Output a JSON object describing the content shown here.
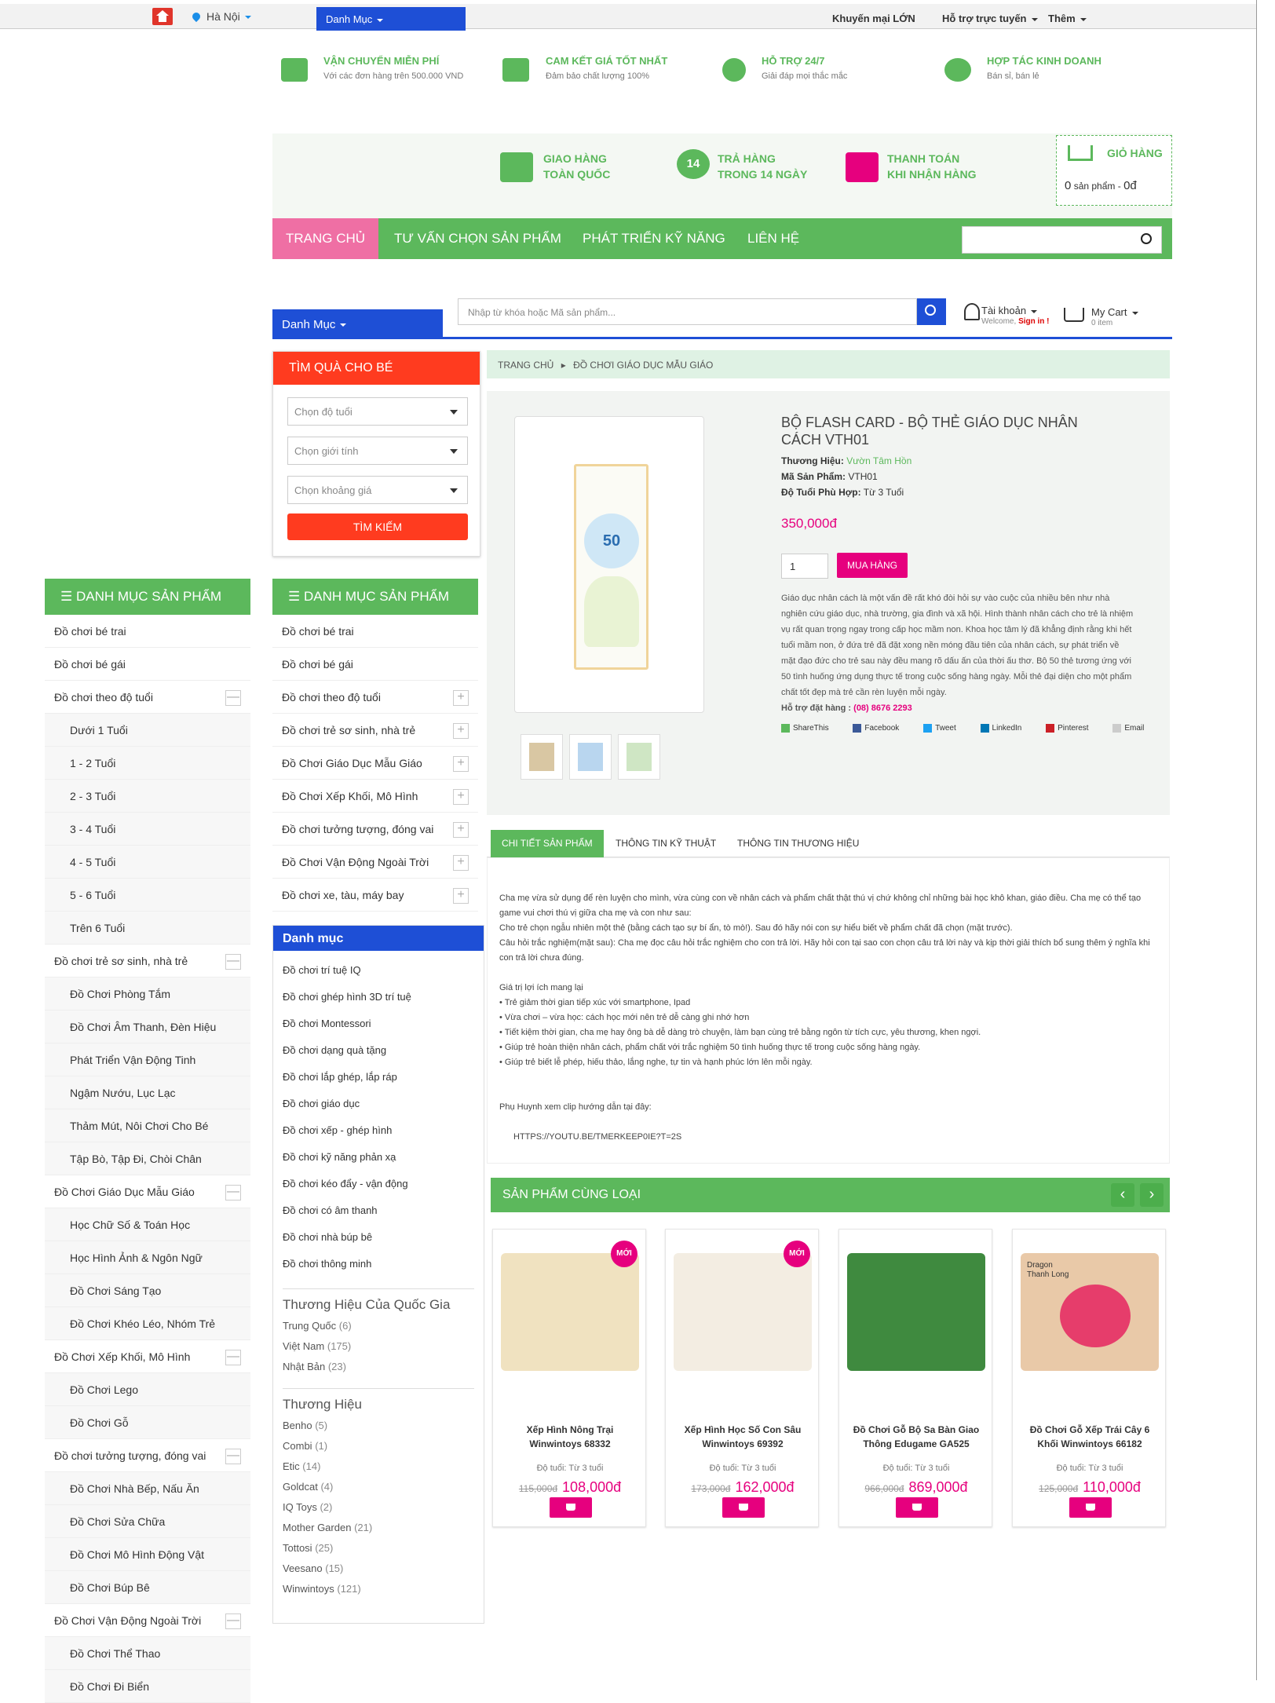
{
  "topbar": {
    "location": "Hà Nội",
    "category": "Danh Mục",
    "links": [
      "Khuyến mại LỚN",
      "Hỗ trợ trực tuyến",
      "Thêm"
    ]
  },
  "services": [
    {
      "title": "VẬN CHUYỂN MIỄN PHÍ",
      "sub": "Với các đơn hàng trên 500.000 VND"
    },
    {
      "title": "CAM KẾT GIÁ TỐT NHẤT",
      "sub": "Đảm bảo chất lượng 100%"
    },
    {
      "title": "HỖ TRỢ 24/7",
      "sub": "Giải đáp mọi thắc mắc"
    },
    {
      "title": "HỢP TÁC KINH DOANH",
      "sub": "Bán sỉ, bán lẻ"
    }
  ],
  "promo": [
    {
      "l1": "GIAO HÀNG",
      "l2": "TOÀN QUỐC"
    },
    {
      "l1": "TRẢ HÀNG",
      "l2": "TRONG 14 NGÀY"
    },
    {
      "l1": "THANH TOÁN",
      "l2": "KHI NHẬN HÀNG"
    }
  ],
  "promo_badge": "14",
  "cart": {
    "title": "GIỎ HÀNG",
    "count": "0",
    "count_label": "sản phẩm",
    "total": "0đ"
  },
  "nav": [
    "TRANG CHỦ",
    "TƯ VẤN CHỌN SẢN PHẨM",
    "PHÁT TRIỂN KỸ NĂNG",
    "LIÊN HỆ"
  ],
  "search": {
    "category": "Danh Mục",
    "placeholder": "Nhập từ khóa hoặc Mã sản phẩm..."
  },
  "account": {
    "title": "Tài khoản",
    "welcome": "Welcome,",
    "signin": "Sign in !",
    "cart_title": "My Cart",
    "cart_items": "0 item"
  },
  "gift": {
    "title": "TÌM QUÀ CHO BÉ",
    "selects": [
      "Chọn độ tuổi",
      "Chọn giới tính",
      "Chọn khoảng giá"
    ],
    "button": "TÌM KIẾM"
  },
  "cat_left": {
    "title": "DANH MỤC SẢN PHẨM",
    "items": [
      {
        "label": "Đồ chơi bé trai",
        "sub": false,
        "pm": ""
      },
      {
        "label": "Đồ chơi bé gái",
        "sub": false,
        "pm": ""
      },
      {
        "label": "Đồ chơi theo độ tuổi",
        "sub": false,
        "pm": "—"
      },
      {
        "label": "Dưới 1 Tuổi",
        "sub": true,
        "pm": ""
      },
      {
        "label": "1 - 2 Tuổi",
        "sub": true,
        "pm": ""
      },
      {
        "label": "2 - 3 Tuổi",
        "sub": true,
        "pm": ""
      },
      {
        "label": "3 - 4 Tuổi",
        "sub": true,
        "pm": ""
      },
      {
        "label": "4 - 5 Tuổi",
        "sub": true,
        "pm": ""
      },
      {
        "label": "5 - 6 Tuổi",
        "sub": true,
        "pm": ""
      },
      {
        "label": "Trên 6 Tuổi",
        "sub": true,
        "pm": ""
      },
      {
        "label": "Đồ chơi trẻ sơ sinh, nhà trẻ",
        "sub": false,
        "pm": "—"
      },
      {
        "label": "Đồ Chơi Phòng Tắm",
        "sub": true,
        "pm": ""
      },
      {
        "label": "Đồ Chơi Âm Thanh, Đèn Hiệu",
        "sub": true,
        "pm": ""
      },
      {
        "label": "Phát Triển Vận Động Tinh",
        "sub": true,
        "pm": ""
      },
      {
        "label": "Ngậm Nướu, Lục Lạc",
        "sub": true,
        "pm": ""
      },
      {
        "label": "Thảm Mút, Nôi Chơi Cho Bé",
        "sub": true,
        "pm": ""
      },
      {
        "label": "Tập Bò, Tập Đi, Chòi Chân",
        "sub": true,
        "pm": ""
      },
      {
        "label": "Đồ Chơi Giáo Dục Mẫu Giáo",
        "sub": false,
        "pm": "—"
      },
      {
        "label": "Học Chữ Số & Toán Học",
        "sub": true,
        "pm": ""
      },
      {
        "label": "Học Hình Ảnh & Ngôn Ngữ",
        "sub": true,
        "pm": ""
      },
      {
        "label": "Đồ Chơi Sáng Tạo",
        "sub": true,
        "pm": ""
      },
      {
        "label": "Đồ Chơi Khéo Léo, Nhóm Trẻ",
        "sub": true,
        "pm": ""
      },
      {
        "label": "Đồ Chơi Xếp Khối, Mô Hình",
        "sub": false,
        "pm": "—"
      },
      {
        "label": "Đồ Chơi Lego",
        "sub": true,
        "pm": ""
      },
      {
        "label": "Đồ Chơi Gỗ",
        "sub": true,
        "pm": ""
      },
      {
        "label": "Đồ chơi tưởng tượng, đóng vai",
        "sub": false,
        "pm": "—"
      },
      {
        "label": "Đồ Chơi Nhà Bếp, Nấu Ăn",
        "sub": true,
        "pm": ""
      },
      {
        "label": "Đồ Chơi Sửa Chữa",
        "sub": true,
        "pm": ""
      },
      {
        "label": "Đồ Chơi Mô Hình Động Vật",
        "sub": true,
        "pm": ""
      },
      {
        "label": "Đồ Chơi Búp Bê",
        "sub": true,
        "pm": ""
      },
      {
        "label": "Đồ Chơi Vận Động Ngoài Trời",
        "sub": false,
        "pm": "—"
      },
      {
        "label": "Đồ Chơi Thể Thao",
        "sub": true,
        "pm": ""
      },
      {
        "label": "Đồ Chơi Đi Biển",
        "sub": true,
        "pm": ""
      }
    ]
  },
  "cat_mid": {
    "title": "DANH MỤC SẢN PHẨM",
    "items": [
      {
        "label": "Đồ chơi bé trai",
        "pm": ""
      },
      {
        "label": "Đồ chơi bé gái",
        "pm": ""
      },
      {
        "label": "Đồ chơi theo độ tuổi",
        "pm": "+"
      },
      {
        "label": "Đồ chơi trẻ sơ sinh, nhà trẻ",
        "pm": "+"
      },
      {
        "label": "Đồ Chơi Giáo Dục Mẫu Giáo",
        "pm": "+"
      },
      {
        "label": "Đồ Chơi Xếp Khối, Mô Hình",
        "pm": "+"
      },
      {
        "label": "Đồ chơi tưởng tượng, đóng vai",
        "pm": "+"
      },
      {
        "label": "Đồ Chơi Vận Động Ngoài Trời",
        "pm": "+"
      },
      {
        "label": "Đồ chơi xe, tàu, máy bay",
        "pm": "+"
      }
    ]
  },
  "danhmuc": {
    "title": "Danh mục",
    "items": [
      "Đồ chơi trí tuệ IQ",
      "Đồ chơi ghép hình 3D trí tuệ",
      "Đồ chơi Montessori",
      "Đồ chơi dạng quà tặng",
      "Đồ chơi lắp ghép, lắp ráp",
      "Đồ chơi giáo dục",
      "Đồ chơi xếp - ghép hình",
      "Đồ chơi kỹ năng phản xạ",
      "Đồ chơi kéo đẩy - vận động",
      "Đồ chơi có âm thanh",
      "Đồ chơi nhà búp bê",
      "Đồ chơi thông minh"
    ]
  },
  "brand_country": {
    "title": "Thương Hiệu Của Quốc Gia",
    "items": [
      {
        "n": "Trung Quốc",
        "c": "(6)"
      },
      {
        "n": "Việt Nam",
        "c": "(175)"
      },
      {
        "n": "Nhật Bản",
        "c": "(23)"
      }
    ]
  },
  "brands": {
    "title": "Thương Hiệu",
    "items": [
      {
        "n": "Benho",
        "c": "(5)"
      },
      {
        "n": "Combi",
        "c": "(1)"
      },
      {
        "n": "Etic",
        "c": "(14)"
      },
      {
        "n": "Goldcat",
        "c": "(4)"
      },
      {
        "n": "IQ Toys",
        "c": "(2)"
      },
      {
        "n": "Mother Garden",
        "c": "(21)"
      },
      {
        "n": "Tottosi",
        "c": "(25)"
      },
      {
        "n": "Veesano",
        "c": "(15)"
      },
      {
        "n": "Winwintoys",
        "c": "(121)"
      }
    ]
  },
  "breadcrumb": {
    "home": "TRANG CHỦ",
    "current": "ĐỒ CHƠI GIÁO DỤC MẪU GIÁO"
  },
  "product": {
    "title": "BỘ FLASH CARD - BỘ THẺ GIÁO DỤC NHÂN CÁCH VTH01",
    "brand_label": "Thương Hiệu:",
    "brand": "Vườn Tâm Hồn",
    "sku_label": "Mã Sản Phẩm:",
    "sku": "VTH01",
    "age_label": "Độ Tuổi Phù Hợp:",
    "age": "Từ 3 Tuổi",
    "price": "350,000đ",
    "qty": "1",
    "buy": "MUA HÀNG",
    "desc": "Giáo dục nhân cách là một vấn đề rất khó đòi hỏi sự vào cuộc của nhiều bên như nhà nghiên cứu giáo dục, nhà trường, gia đình và xã hội. Hình thành nhân cách cho trẻ là nhiệm vụ rất quan trọng ngay trong cấp học mầm non. Khoa học tâm lý đã khẳng định rằng khi hết tuổi mầm non, ở đứa trẻ đã đặt xong nền móng đầu tiên của nhân cách, sự phát triển về mặt đạo đức cho trẻ sau này đều mang rõ dấu ấn của thời ấu thơ. Bộ 50 thẻ tương ứng với 50 tình huống ứng dụng thực tế trong cuộc sống hàng ngày. Mỗi thẻ đại diện cho một phẩm chất tốt đẹp mà trẻ cần rèn luyện mỗi ngày.",
    "hotline_label": "Hỗ trợ đặt hàng :",
    "hotline": "(08) 8676 2293",
    "share": [
      "ShareThis",
      "Facebook",
      "Tweet",
      "LinkedIn",
      "Pinterest",
      "Email"
    ],
    "box_text": "50"
  },
  "tabs": [
    "CHI TIẾT SẢN PHẨM",
    "THÔNG TIN KỸ THUẬT",
    "THÔNG TIN THƯƠNG HIỆU"
  ],
  "details": [
    "Cha mẹ vừa sử dụng để rèn luyện cho mình, vừa cùng con về nhân cách và phẩm chất thật thú vị chứ không chỉ những bài học khô khan, giáo điều. Cha mẹ có thể tạo game vui chơi thú vị giữa cha mẹ và con như sau:",
    "Cho trẻ chọn ngẫu nhiên một thẻ (bằng cách tạo sự bí ẩn, tò mò!). Sau đó hãy nói con sự hiểu biết về phẩm chất đã chọn (mặt trước).",
    "Câu hỏi trắc nghiệm(mặt sau): Cha mẹ đọc câu hỏi trắc nghiệm cho con trả lời. Hãy hỏi con tại sao con chọn câu trả lời này và kịp thời giải thích bổ sung thêm ý nghĩa khi con trả lời chưa đúng.",
    "",
    "Giá trị lợi ích mang lại",
    "• Trẻ giảm thời gian tiếp xúc với smartphone, Ipad",
    "• Vừa chơi – vừa học: cách học mới nên trẻ dễ càng ghi nhớ hơn",
    "• Tiết kiệm thời gian, cha mẹ hay ông bà dễ dàng trò chuyện, làm bạn cùng trẻ bằng ngôn từ tích cực, yêu thương, khen ngợi.",
    "• Giúp trẻ hoàn thiện nhân cách, phẩm chất với trắc nghiệm 50 tình huống thực tế trong cuộc sống hàng ngày.",
    "• Giúp trẻ biết lễ phép, hiếu thảo, lắng nghe, tự tin và hạnh phúc lớn lên mỗi ngày.",
    "",
    "",
    "Phụ Huynh xem clip hướng dẫn tại đây:",
    "",
    "      HTTPS://YOUTU.BE/TMERKEEP0IE?T=2S"
  ],
  "similar": {
    "title": "SẢN PHẨM CÙNG LOẠI",
    "badge": "MỚI",
    "items": [
      {
        "name": "Xếp Hình Nông Trại Winwintoys 68332",
        "age": "Độ tuổi: Từ 3 tuổi",
        "old": "115,000đ",
        "price": "108,000đ",
        "new": true,
        "color": "#f0e2c0"
      },
      {
        "name": "Xếp Hình Học Số Con Sâu Winwintoys 69392",
        "age": "Độ tuổi: Từ 3 tuổi",
        "old": "173,000đ",
        "price": "162,000đ",
        "new": true,
        "color": "#f3ede2"
      },
      {
        "name": "Đồ Chơi Gỗ Bộ Sa Bàn Giao Thông Edugame GA525",
        "age": "Độ tuổi: Từ 3 tuổi",
        "old": "966,000đ",
        "price": "869,000đ",
        "new": false,
        "color": "#3f8a3f"
      },
      {
        "name": "Đồ Chơi Gỗ Xếp Trái Cây 6 Khối Winwintoys 66182",
        "age": "Độ tuổi: Từ 3 tuổi",
        "old": "125,000đ",
        "price": "110,000đ",
        "new": false,
        "color": "#e9c9a8"
      }
    ]
  },
  "fruit_label": "Dragon Thanh Long"
}
